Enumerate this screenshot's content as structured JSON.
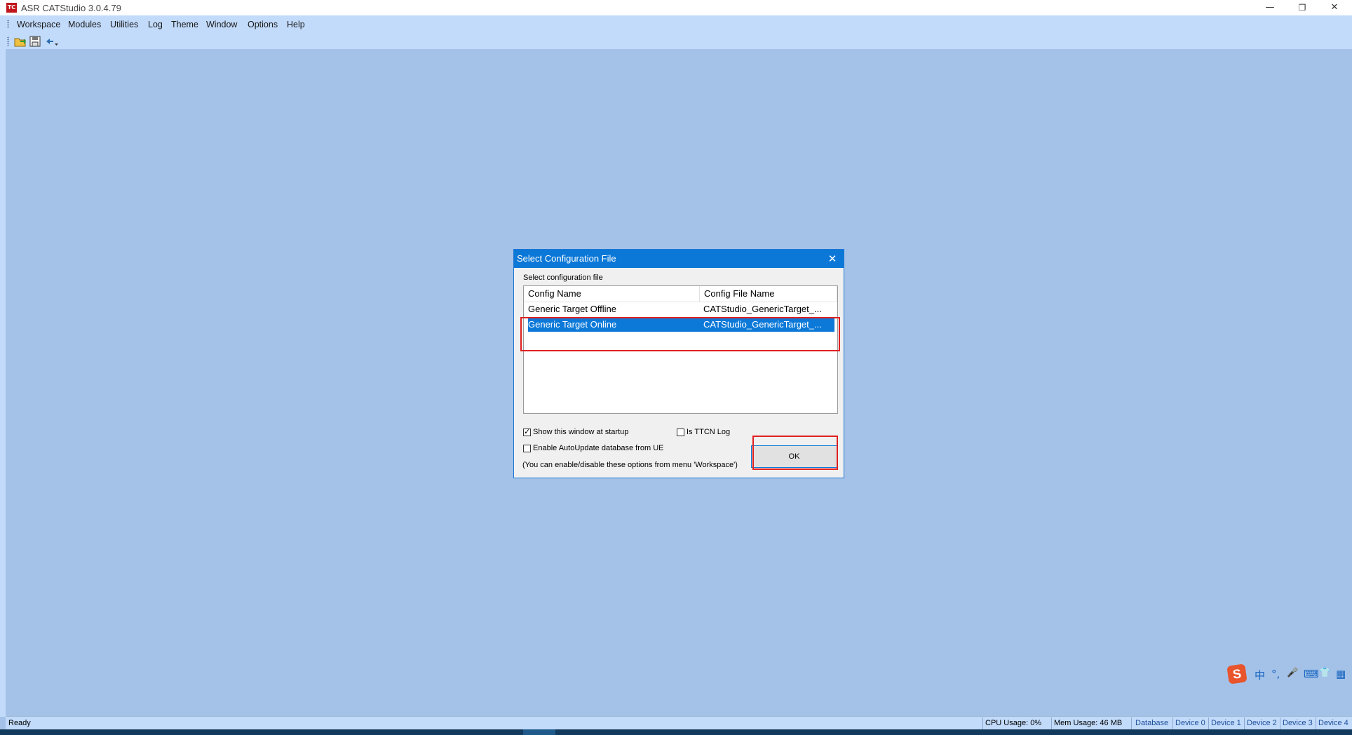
{
  "window": {
    "app_icon_text": "TC",
    "title": "ASR CATStudio 3.0.4.79",
    "controls": {
      "minimize": "—",
      "restore": "❐",
      "close": "✕"
    }
  },
  "menu": {
    "items": [
      "Workspace",
      "Modules",
      "Utilities",
      "Log",
      "Theme",
      "Window",
      "Options",
      "Help"
    ]
  },
  "toolbar": {
    "buttons": [
      "open-icon",
      "save-icon",
      "arrow-dropdown-icon"
    ]
  },
  "dialog": {
    "title": "Select Configuration File",
    "close_symbol": "✕",
    "group_label": "Select configuration file",
    "columns": [
      "Config Name",
      "Config File Name"
    ],
    "rows": [
      {
        "name": "Generic Target Offline",
        "file": "CATStudio_GenericTarget_...",
        "selected": false
      },
      {
        "name": "Generic Target Online",
        "file": "CATStudio_GenericTarget_...",
        "selected": true
      }
    ],
    "options": {
      "show_at_startup": {
        "label": "Show this window at startup",
        "checked": true
      },
      "is_ttcn_log": {
        "label": "Is TTCN Log",
        "checked": false
      },
      "enable_autoupdate": {
        "label": "Enable AutoUpdate database from UE",
        "checked": false
      }
    },
    "note": "(You can enable/disable these options from menu 'Workspace')",
    "ok_label": "OK"
  },
  "ime": {
    "logo": "S",
    "icons": [
      "中",
      "°,",
      "🎤",
      "⌨",
      "👕",
      "▦"
    ]
  },
  "statusbar": {
    "ready": "Ready",
    "cpu": "CPU Usage:  0%",
    "mem": "Mem Usage: 46 MB",
    "database": "Database",
    "devices": [
      "Device 0",
      "Device 1",
      "Device 2",
      "Device 3",
      "Device 4"
    ]
  },
  "colors": {
    "workspace_bg": "#a4c2e8",
    "bar_bg": "#c2dbfb",
    "dialog_title": "#0b78d7",
    "selection": "#0c79d8",
    "highlight_box": "#e02020"
  }
}
